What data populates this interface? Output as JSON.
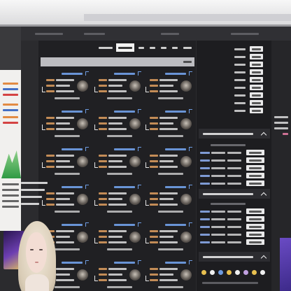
{
  "colors": {
    "page_background": "#202023",
    "side_background": "#1d1d20",
    "title_blue": "#6e9be0",
    "text_orange": "#e0a060",
    "text_white": "#e8e8e8",
    "selected_tab": "#f2f2f2",
    "left_strip_orange": "#e08030",
    "left_strip_blue": "#3060c0",
    "left_strip_red": "#d03030",
    "logo_green": "#2f9a44",
    "accent_purple": "#5b3fb0"
  },
  "nav": {
    "selected_tab_index": 1
  },
  "icons": {
    "section_toggle": "chevron-up-icon",
    "player": "avatar-icon",
    "row_marker": "bracket-icon"
  }
}
